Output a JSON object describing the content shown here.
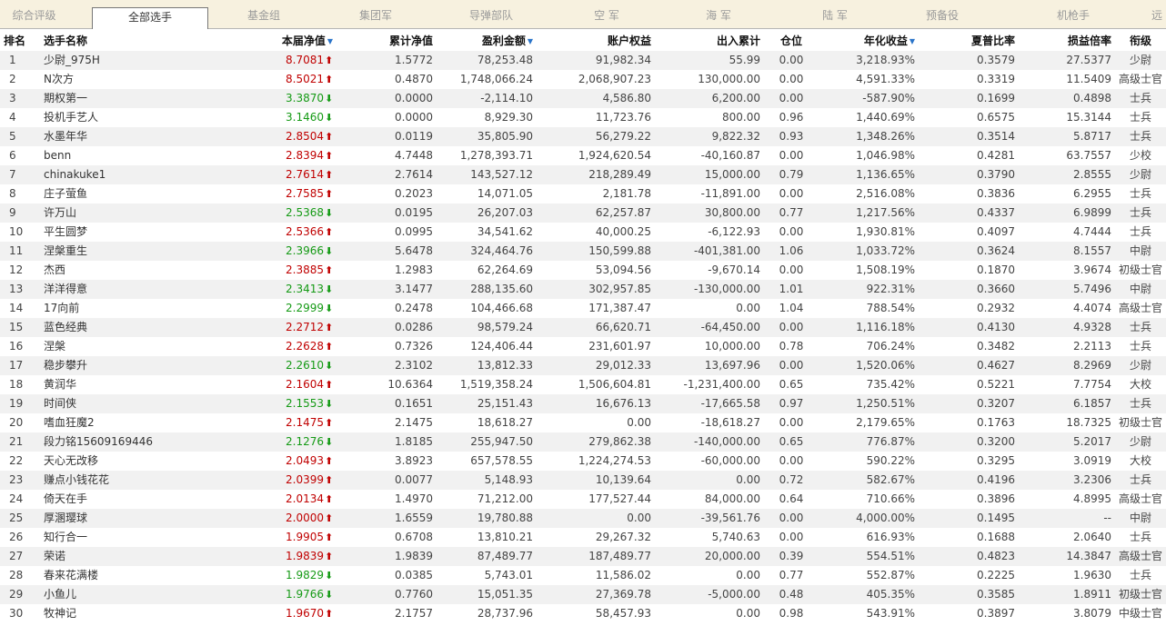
{
  "tabs": [
    {
      "label": "综合评级",
      "active": false
    },
    {
      "label": "全部选手",
      "active": true
    },
    {
      "label": "基金组",
      "active": false
    },
    {
      "label": "集团军",
      "active": false
    },
    {
      "label": "导弹部队",
      "active": false
    },
    {
      "label": "空  军",
      "active": false
    },
    {
      "label": "海  军",
      "active": false
    },
    {
      "label": "陆  军",
      "active": false
    },
    {
      "label": "预备役",
      "active": false
    },
    {
      "label": "机枪手",
      "active": false
    },
    {
      "label": "远",
      "active": false
    }
  ],
  "columns": [
    {
      "key": "rank",
      "label": "排名",
      "sorted": false
    },
    {
      "key": "name",
      "label": "选手名称",
      "sorted": false
    },
    {
      "key": "nav",
      "label": "本届净值",
      "sorted": true
    },
    {
      "key": "cum_nav",
      "label": "累计净值",
      "sorted": false
    },
    {
      "key": "profit",
      "label": "盈利金额",
      "sorted": true
    },
    {
      "key": "equity",
      "label": "账户权益",
      "sorted": false
    },
    {
      "key": "flow",
      "label": "出入累计",
      "sorted": false
    },
    {
      "key": "position",
      "label": "仓位",
      "sorted": false
    },
    {
      "key": "annual",
      "label": "年化收益",
      "sorted": true
    },
    {
      "key": "sharpe",
      "label": "夏普比率",
      "sorted": false
    },
    {
      "key": "pl_ratio",
      "label": "损益倍率",
      "sorted": false
    },
    {
      "key": "grade",
      "label": "衔级",
      "sorted": false
    }
  ],
  "icons": {
    "sort": "sort-desc-icon",
    "up": "arrow-up-icon",
    "down": "arrow-down-icon"
  },
  "colors": {
    "up": "#c00000",
    "down": "#159a15",
    "sort": "#2a74c9",
    "tabbar": "#f7f1df"
  },
  "rows": [
    {
      "rank": "1",
      "name": "少尉_975H",
      "nav": "8.7081",
      "trend": "up",
      "cum_nav": "1.5772",
      "profit": "78,253.48",
      "equity": "91,982.34",
      "flow": "55.99",
      "position": "0.00",
      "annual": "3,218.93%",
      "sharpe": "0.3579",
      "pl_ratio": "27.5377",
      "grade": "少尉"
    },
    {
      "rank": "2",
      "name": "N次方",
      "nav": "8.5021",
      "trend": "up",
      "cum_nav": "0.4870",
      "profit": "1,748,066.24",
      "equity": "2,068,907.23",
      "flow": "130,000.00",
      "position": "0.00",
      "annual": "4,591.33%",
      "sharpe": "0.3319",
      "pl_ratio": "11.5409",
      "grade": "高级士官"
    },
    {
      "rank": "3",
      "name": "期权第一",
      "nav": "3.3870",
      "trend": "down",
      "cum_nav": "0.0000",
      "profit": "-2,114.10",
      "equity": "4,586.80",
      "flow": "6,200.00",
      "position": "0.00",
      "annual": "-587.90%",
      "sharpe": "0.1699",
      "pl_ratio": "0.4898",
      "grade": "士兵"
    },
    {
      "rank": "4",
      "name": "投机手艺人",
      "nav": "3.1460",
      "trend": "down",
      "cum_nav": "0.0000",
      "profit": "8,929.30",
      "equity": "11,723.76",
      "flow": "800.00",
      "position": "0.96",
      "annual": "1,440.69%",
      "sharpe": "0.6575",
      "pl_ratio": "15.3144",
      "grade": "士兵"
    },
    {
      "rank": "5",
      "name": "水墨年华",
      "nav": "2.8504",
      "trend": "up",
      "cum_nav": "0.0119",
      "profit": "35,805.90",
      "equity": "56,279.22",
      "flow": "9,822.32",
      "position": "0.93",
      "annual": "1,348.26%",
      "sharpe": "0.3514",
      "pl_ratio": "5.8717",
      "grade": "士兵"
    },
    {
      "rank": "6",
      "name": "benn",
      "nav": "2.8394",
      "trend": "up",
      "cum_nav": "4.7448",
      "profit": "1,278,393.71",
      "equity": "1,924,620.54",
      "flow": "-40,160.87",
      "position": "0.00",
      "annual": "1,046.98%",
      "sharpe": "0.4281",
      "pl_ratio": "63.7557",
      "grade": "少校"
    },
    {
      "rank": "7",
      "name": "chinakuke1",
      "nav": "2.7614",
      "trend": "up",
      "cum_nav": "2.7614",
      "profit": "143,527.12",
      "equity": "218,289.49",
      "flow": "15,000.00",
      "position": "0.79",
      "annual": "1,136.65%",
      "sharpe": "0.3790",
      "pl_ratio": "2.8555",
      "grade": "少尉"
    },
    {
      "rank": "8",
      "name": "庄子萤鱼",
      "nav": "2.7585",
      "trend": "up",
      "cum_nav": "0.2023",
      "profit": "14,071.05",
      "equity": "2,181.78",
      "flow": "-11,891.00",
      "position": "0.00",
      "annual": "2,516.08%",
      "sharpe": "0.3836",
      "pl_ratio": "6.2955",
      "grade": "士兵"
    },
    {
      "rank": "9",
      "name": "许万山",
      "nav": "2.5368",
      "trend": "down",
      "cum_nav": "0.0195",
      "profit": "26,207.03",
      "equity": "62,257.87",
      "flow": "30,800.00",
      "position": "0.77",
      "annual": "1,217.56%",
      "sharpe": "0.4337",
      "pl_ratio": "6.9899",
      "grade": "士兵"
    },
    {
      "rank": "10",
      "name": "平生圆梦",
      "nav": "2.5366",
      "trend": "up",
      "cum_nav": "0.0995",
      "profit": "34,541.62",
      "equity": "40,000.25",
      "flow": "-6,122.93",
      "position": "0.00",
      "annual": "1,930.81%",
      "sharpe": "0.4097",
      "pl_ratio": "4.7444",
      "grade": "士兵"
    },
    {
      "rank": "11",
      "name": "涅槃重生",
      "nav": "2.3966",
      "trend": "down",
      "cum_nav": "5.6478",
      "profit": "324,464.76",
      "equity": "150,599.88",
      "flow": "-401,381.00",
      "position": "1.06",
      "annual": "1,033.72%",
      "sharpe": "0.3624",
      "pl_ratio": "8.1557",
      "grade": "中尉"
    },
    {
      "rank": "12",
      "name": "杰西",
      "nav": "2.3885",
      "trend": "up",
      "cum_nav": "1.2983",
      "profit": "62,264.69",
      "equity": "53,094.56",
      "flow": "-9,670.14",
      "position": "0.00",
      "annual": "1,508.19%",
      "sharpe": "0.1870",
      "pl_ratio": "3.9674",
      "grade": "初级士官"
    },
    {
      "rank": "13",
      "name": "洋洋得意",
      "nav": "2.3413",
      "trend": "down",
      "cum_nav": "3.1477",
      "profit": "288,135.60",
      "equity": "302,957.85",
      "flow": "-130,000.00",
      "position": "1.01",
      "annual": "922.31%",
      "sharpe": "0.3660",
      "pl_ratio": "5.7496",
      "grade": "中尉"
    },
    {
      "rank": "14",
      "name": "17向前",
      "nav": "2.2999",
      "trend": "down",
      "cum_nav": "0.2478",
      "profit": "104,466.68",
      "equity": "171,387.47",
      "flow": "0.00",
      "position": "1.04",
      "annual": "788.54%",
      "sharpe": "0.2932",
      "pl_ratio": "4.4074",
      "grade": "高级士官"
    },
    {
      "rank": "15",
      "name": "蓝色经典",
      "nav": "2.2712",
      "trend": "up",
      "cum_nav": "0.0286",
      "profit": "98,579.24",
      "equity": "66,620.71",
      "flow": "-64,450.00",
      "position": "0.00",
      "annual": "1,116.18%",
      "sharpe": "0.4130",
      "pl_ratio": "4.9328",
      "grade": "士兵"
    },
    {
      "rank": "16",
      "name": "涅槃",
      "nav": "2.2628",
      "trend": "up",
      "cum_nav": "0.7326",
      "profit": "124,406.44",
      "equity": "231,601.97",
      "flow": "10,000.00",
      "position": "0.78",
      "annual": "706.24%",
      "sharpe": "0.3482",
      "pl_ratio": "2.2113",
      "grade": "士兵"
    },
    {
      "rank": "17",
      "name": "稳步攀升",
      "nav": "2.2610",
      "trend": "down",
      "cum_nav": "2.3102",
      "profit": "13,812.33",
      "equity": "29,012.33",
      "flow": "13,697.96",
      "position": "0.00",
      "annual": "1,520.06%",
      "sharpe": "0.4627",
      "pl_ratio": "8.2969",
      "grade": "少尉"
    },
    {
      "rank": "18",
      "name": "黄润华",
      "nav": "2.1604",
      "trend": "up",
      "cum_nav": "10.6364",
      "profit": "1,519,358.24",
      "equity": "1,506,604.81",
      "flow": "-1,231,400.00",
      "position": "0.65",
      "annual": "735.42%",
      "sharpe": "0.5221",
      "pl_ratio": "7.7754",
      "grade": "大校"
    },
    {
      "rank": "19",
      "name": "时间侠",
      "nav": "2.1553",
      "trend": "down",
      "cum_nav": "0.1651",
      "profit": "25,151.43",
      "equity": "16,676.13",
      "flow": "-17,665.58",
      "position": "0.97",
      "annual": "1,250.51%",
      "sharpe": "0.3207",
      "pl_ratio": "6.1857",
      "grade": "士兵"
    },
    {
      "rank": "20",
      "name": "嗜血狂魔2",
      "nav": "2.1475",
      "trend": "up",
      "cum_nav": "2.1475",
      "profit": "18,618.27",
      "equity": "0.00",
      "flow": "-18,618.27",
      "position": "0.00",
      "annual": "2,179.65%",
      "sharpe": "0.1763",
      "pl_ratio": "18.7325",
      "grade": "初级士官"
    },
    {
      "rank": "21",
      "name": "段力铭15609169446",
      "nav": "2.1276",
      "trend": "down",
      "cum_nav": "1.8185",
      "profit": "255,947.50",
      "equity": "279,862.38",
      "flow": "-140,000.00",
      "position": "0.65",
      "annual": "776.87%",
      "sharpe": "0.3200",
      "pl_ratio": "5.2017",
      "grade": "少尉"
    },
    {
      "rank": "22",
      "name": "天心无改移",
      "nav": "2.0493",
      "trend": "up",
      "cum_nav": "3.8923",
      "profit": "657,578.55",
      "equity": "1,224,274.53",
      "flow": "-60,000.00",
      "position": "0.00",
      "annual": "590.22%",
      "sharpe": "0.3295",
      "pl_ratio": "3.0919",
      "grade": "大校"
    },
    {
      "rank": "23",
      "name": "赚点小钱花花",
      "nav": "2.0399",
      "trend": "up",
      "cum_nav": "0.0077",
      "profit": "5,148.93",
      "equity": "10,139.64",
      "flow": "0.00",
      "position": "0.72",
      "annual": "582.67%",
      "sharpe": "0.4196",
      "pl_ratio": "3.2306",
      "grade": "士兵"
    },
    {
      "rank": "24",
      "name": "倚天在手",
      "nav": "2.0134",
      "trend": "up",
      "cum_nav": "1.4970",
      "profit": "71,212.00",
      "equity": "177,527.44",
      "flow": "84,000.00",
      "position": "0.64",
      "annual": "710.66%",
      "sharpe": "0.3896",
      "pl_ratio": "4.8995",
      "grade": "高级士官"
    },
    {
      "rank": "25",
      "name": "厚溷璎球",
      "nav": "2.0000",
      "trend": "up",
      "cum_nav": "1.6559",
      "profit": "19,780.88",
      "equity": "0.00",
      "flow": "-39,561.76",
      "position": "0.00",
      "annual": "4,000.00%",
      "sharpe": "0.1495",
      "pl_ratio": "--",
      "grade": "中尉"
    },
    {
      "rank": "26",
      "name": "知行合一",
      "nav": "1.9905",
      "trend": "up",
      "cum_nav": "0.6708",
      "profit": "13,810.21",
      "equity": "29,267.32",
      "flow": "5,740.63",
      "position": "0.00",
      "annual": "616.93%",
      "sharpe": "0.1688",
      "pl_ratio": "2.0640",
      "grade": "士兵"
    },
    {
      "rank": "27",
      "name": "荣诺",
      "nav": "1.9839",
      "trend": "up",
      "cum_nav": "1.9839",
      "profit": "87,489.77",
      "equity": "187,489.77",
      "flow": "20,000.00",
      "position": "0.39",
      "annual": "554.51%",
      "sharpe": "0.4823",
      "pl_ratio": "14.3847",
      "grade": "高级士官"
    },
    {
      "rank": "28",
      "name": "春来花满楼",
      "nav": "1.9829",
      "trend": "down",
      "cum_nav": "0.0385",
      "profit": "5,743.01",
      "equity": "11,586.02",
      "flow": "0.00",
      "position": "0.77",
      "annual": "552.87%",
      "sharpe": "0.2225",
      "pl_ratio": "1.9630",
      "grade": "士兵"
    },
    {
      "rank": "29",
      "name": "小鱼儿",
      "nav": "1.9766",
      "trend": "down",
      "cum_nav": "0.7760",
      "profit": "15,051.35",
      "equity": "27,369.78",
      "flow": "-5,000.00",
      "position": "0.48",
      "annual": "405.35%",
      "sharpe": "0.3585",
      "pl_ratio": "1.8911",
      "grade": "初级士官"
    },
    {
      "rank": "30",
      "name": "牧神记",
      "nav": "1.9670",
      "trend": "up",
      "cum_nav": "2.1757",
      "profit": "28,737.96",
      "equity": "58,457.93",
      "flow": "0.00",
      "position": "0.98",
      "annual": "543.91%",
      "sharpe": "0.3897",
      "pl_ratio": "3.8079",
      "grade": "中级士官"
    }
  ]
}
